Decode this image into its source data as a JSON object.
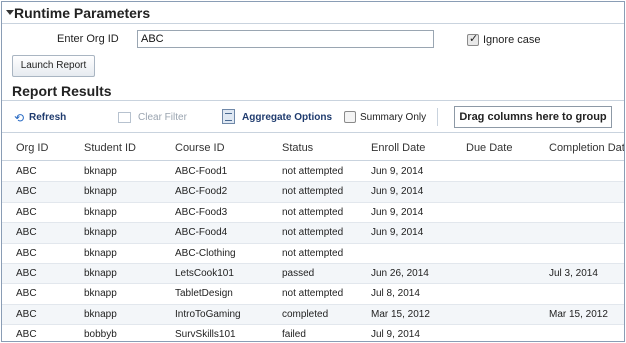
{
  "runtime_parameters": {
    "title": "Runtime Parameters",
    "org_id_label": "Enter Org ID",
    "org_id_value": "ABC",
    "ignore_case_label": "Ignore case",
    "ignore_case_checked": true,
    "launch_button": "Launch Report"
  },
  "report_results": {
    "title": "Report Results",
    "toolbar": {
      "refresh": "Refresh",
      "clear_filter": "Clear Filter",
      "aggregate_options": "Aggregate Options",
      "summary_only": "Summary Only",
      "summary_only_checked": false,
      "group_box": "Drag columns here to group"
    },
    "columns": [
      "Org ID",
      "Student ID",
      "Course ID",
      "Status",
      "Enroll Date",
      "Due Date",
      "Completion Dat"
    ],
    "rows": [
      [
        "ABC",
        "bknapp",
        "ABC-Food1",
        "not attempted",
        "Jun 9, 2014",
        "",
        ""
      ],
      [
        "ABC",
        "bknapp",
        "ABC-Food2",
        "not attempted",
        "Jun 9, 2014",
        "",
        ""
      ],
      [
        "ABC",
        "bknapp",
        "ABC-Food3",
        "not attempted",
        "Jun 9, 2014",
        "",
        ""
      ],
      [
        "ABC",
        "bknapp",
        "ABC-Food4",
        "not attempted",
        "Jun 9, 2014",
        "",
        ""
      ],
      [
        "ABC",
        "bknapp",
        "ABC-Clothing",
        "not attempted",
        "",
        "",
        ""
      ],
      [
        "ABC",
        "bknapp",
        "LetsCook101",
        "passed",
        "Jun 26, 2014",
        "",
        "Jul 3, 2014"
      ],
      [
        "ABC",
        "bknapp",
        "TabletDesign",
        "not attempted",
        "Jul 8, 2014",
        "",
        ""
      ],
      [
        "ABC",
        "bknapp",
        "IntroToGaming",
        "completed",
        "Mar 15, 2012",
        "",
        "Mar 15, 2012"
      ],
      [
        "ABC",
        "bobbyb",
        "SurvSkills101",
        "failed",
        "Jul 9, 2014",
        "",
        ""
      ]
    ]
  },
  "icons": {
    "refresh": "refresh-icon",
    "clear_filter": "clear-filter-icon",
    "aggregate": "aggregate-options-icon",
    "collapse": "collapse-triangle-icon"
  }
}
